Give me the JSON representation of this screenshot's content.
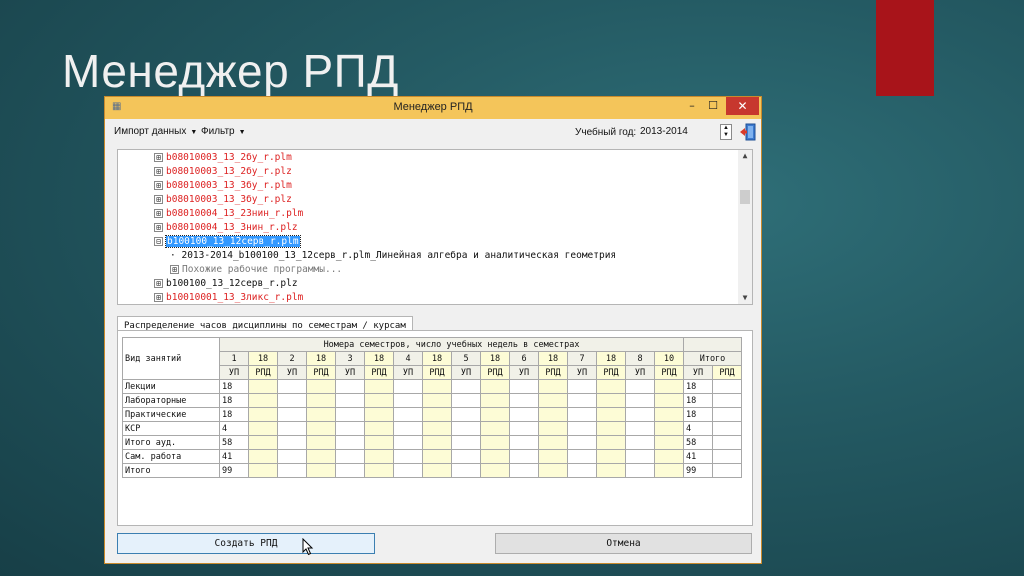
{
  "slide_title": "Менеджер РПД",
  "colors": {
    "accent_red": "#a8141a",
    "titlebar": "#f4c55a",
    "selection": "#3399ff",
    "tree_red": "#dd2222"
  },
  "window": {
    "title": "Менеджер РПД",
    "controls": {
      "minimize": "–",
      "maximize": "☐",
      "close": "✕"
    },
    "icons": {
      "app": "grid-app-icon",
      "exit": "exit-door-icon"
    }
  },
  "menubar": {
    "import": "Импорт данных",
    "filter": "Фильтр",
    "year_label": "Учебный год:",
    "year_value": "2013-2014"
  },
  "tree": {
    "items": [
      {
        "text": "b08010003_13_2бу_r.plm",
        "color": "red",
        "expander": "⊞"
      },
      {
        "text": "b08010003_13_2бу_r.plz",
        "color": "red",
        "expander": "⊞"
      },
      {
        "text": "b08010003_13_3бу_r.plm",
        "color": "red",
        "expander": "⊞"
      },
      {
        "text": "b08010003_13_3бу_r.plz",
        "color": "red",
        "expander": "⊞"
      },
      {
        "text": "b08010004_13_23нин_r.plm",
        "color": "red",
        "expander": "⊞"
      },
      {
        "text": "b08010004_13_3нин_r.plz",
        "color": "red",
        "expander": "⊞"
      },
      {
        "text": "b100100_13_12серв_r.plm",
        "color": "selected",
        "expander": "⊟"
      },
      {
        "text": "2013-2014_b100100_13_12серв_r.plm_Линейная алгебра и аналитическая геометрия",
        "color": "black",
        "expander": ""
      },
      {
        "text": "Похожие рабочие программы...",
        "color": "gray",
        "expander": "⊞"
      },
      {
        "text": "b100100_13_12серв_r.plz",
        "color": "black",
        "expander": "⊞"
      },
      {
        "text": "b10010001_13_3ликс_r.plm",
        "color": "red",
        "expander": "⊞"
      }
    ]
  },
  "tab_label": "Распределение часов дисциплины по семестрам / курсам",
  "grid": {
    "row_header": "Вид занятий",
    "group_header": "Номера семестров, число учебных недель в семестрах",
    "semesters": [
      {
        "num": "1",
        "weeks": "18"
      },
      {
        "num": "2",
        "weeks": "18"
      },
      {
        "num": "3",
        "weeks": "18"
      },
      {
        "num": "4",
        "weeks": "18"
      },
      {
        "num": "5",
        "weeks": "18"
      },
      {
        "num": "6",
        "weeks": "18"
      },
      {
        "num": "7",
        "weeks": "18"
      },
      {
        "num": "8",
        "weeks": "10"
      }
    ],
    "total_header": "Итого",
    "sub_up": "УП",
    "sub_rpd": "РПД",
    "rows": [
      {
        "label": "Лекции",
        "s1_up": "18",
        "total_up": "18"
      },
      {
        "label": "Лабораторные",
        "s1_up": "18",
        "total_up": "18"
      },
      {
        "label": "Практические",
        "s1_up": "18",
        "total_up": "18"
      },
      {
        "label": "КСР",
        "s1_up": "4",
        "total_up": "4"
      },
      {
        "label": "Итого ауд.",
        "s1_up": "58",
        "total_up": "58"
      },
      {
        "label": "Сам. работа",
        "s1_up": "41",
        "total_up": "41"
      },
      {
        "label": "Итого",
        "s1_up": "99",
        "total_up": "99"
      }
    ]
  },
  "buttons": {
    "create": "Создать РПД",
    "cancel": "Отмена"
  }
}
